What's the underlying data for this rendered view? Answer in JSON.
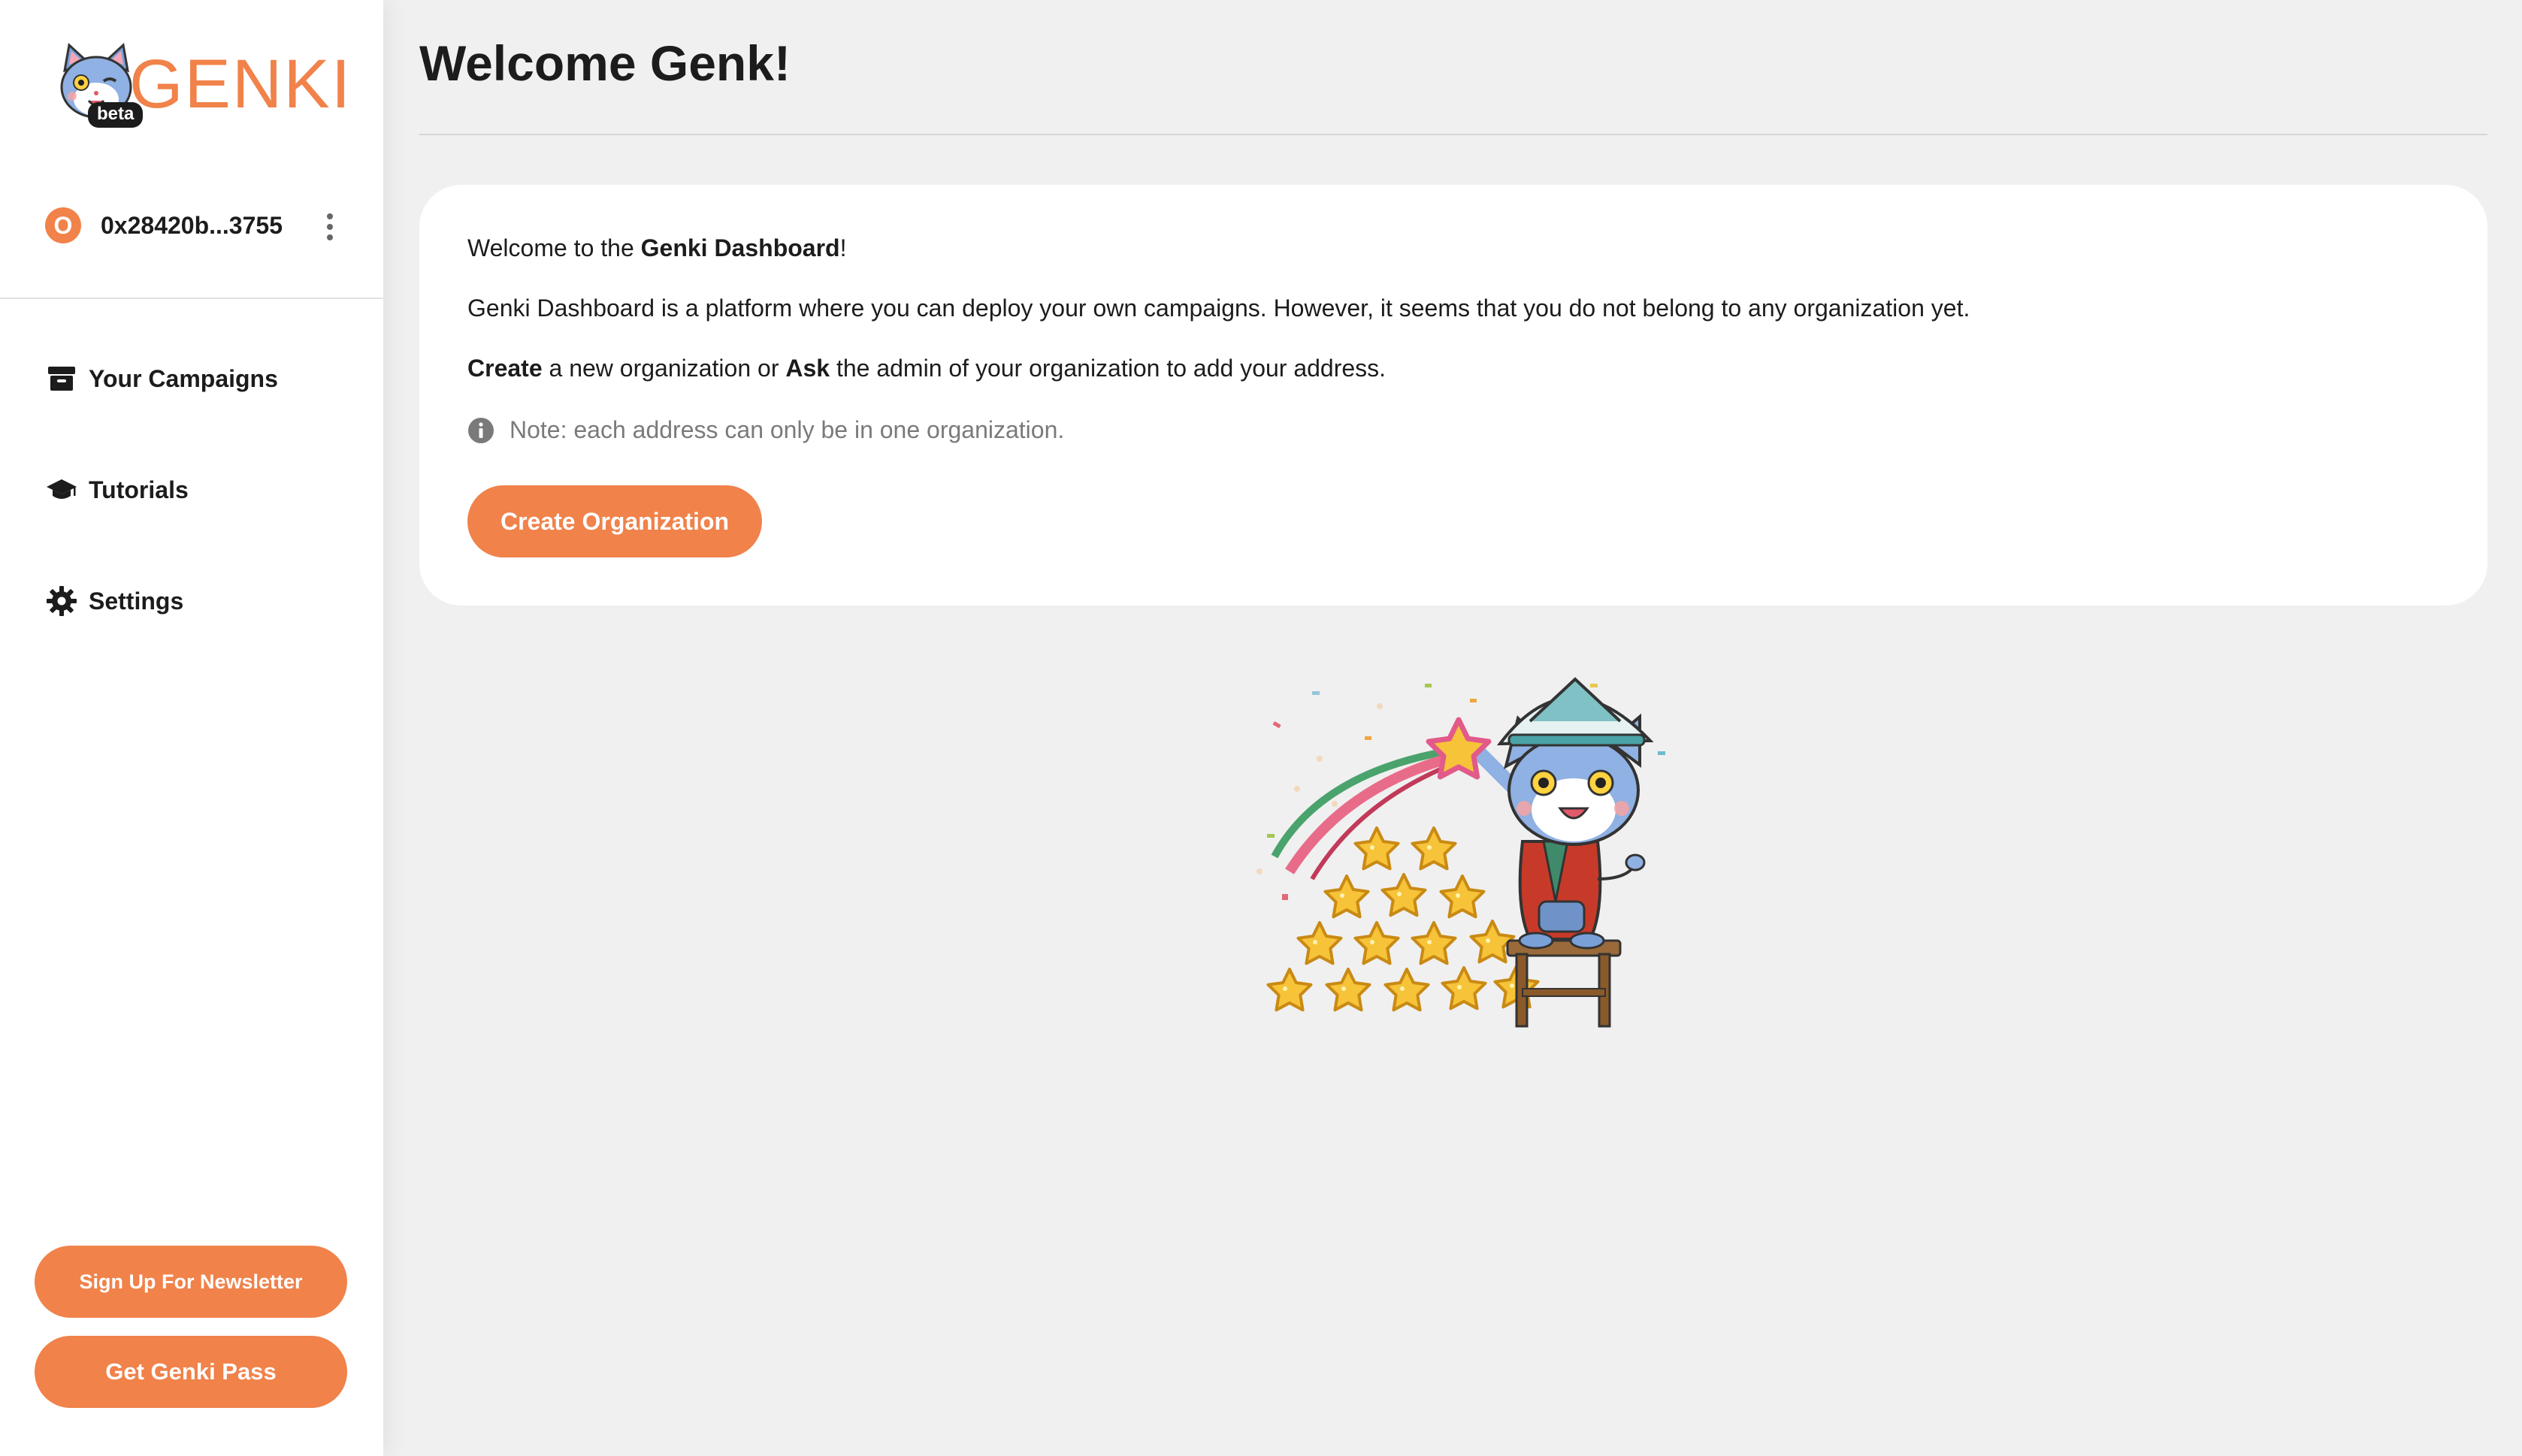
{
  "brand": {
    "name": "GENKI",
    "badge": "beta",
    "accent_color": "#f0824a"
  },
  "account": {
    "avatar_letter": "O",
    "address": "0x28420b...3755",
    "menu_icon": "more-vertical-icon"
  },
  "sidebar": {
    "items": [
      {
        "label": "Your Campaigns",
        "icon": "archive-box-icon"
      },
      {
        "label": "Tutorials",
        "icon": "graduation-cap-icon"
      },
      {
        "label": "Settings",
        "icon": "gear-icon"
      }
    ],
    "newsletter_button": "Sign Up For Newsletter",
    "pass_button": "Get Genki Pass"
  },
  "main": {
    "title": "Welcome Genk!",
    "card": {
      "line1_prefix": "Welcome to the ",
      "line1_bold": "Genki Dashboard",
      "line1_suffix": "!",
      "line2": "Genki Dashboard is a platform where you can deploy your own campaigns. However, it seems that you do not belong to any organization yet.",
      "line3_bold1": "Create",
      "line3_mid": " a new organization or ",
      "line3_bold2": "Ask",
      "line3_suffix": " the admin of your organization to add your address.",
      "note": "Note: each address can only be in one organization.",
      "note_icon": "info-icon",
      "create_button": "Create Organization"
    },
    "illustration": "cat-mascot-with-stars-illustration"
  }
}
